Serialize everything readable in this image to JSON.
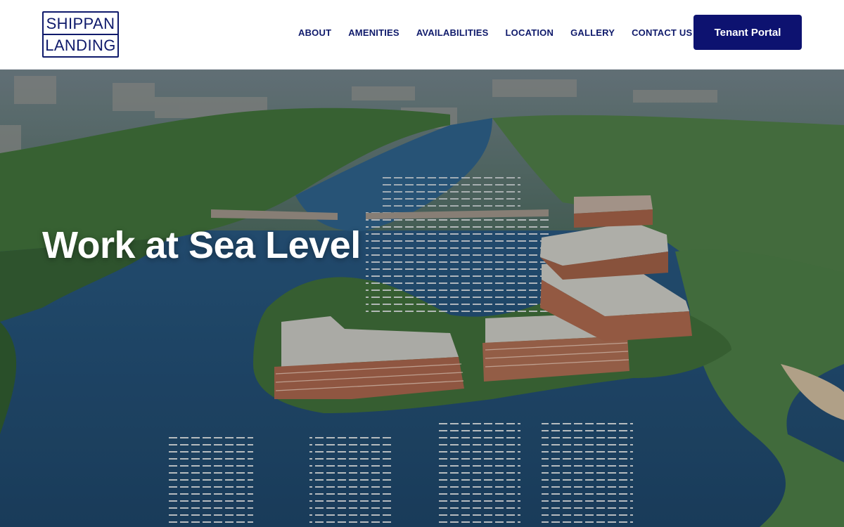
{
  "brand": {
    "logo_line1": "SHIPPAN",
    "logo_line2": "LANDING",
    "color": "#0f1a6b"
  },
  "nav": {
    "items": [
      {
        "label": "ABOUT"
      },
      {
        "label": "AMENITIES"
      },
      {
        "label": "AVAILABILITIES"
      },
      {
        "label": "LOCATION"
      },
      {
        "label": "GALLERY"
      },
      {
        "label": "CONTACT US"
      }
    ]
  },
  "header": {
    "portal_label": "Tenant Portal",
    "portal_color": "#0d1270"
  },
  "hero": {
    "title": "Work at Sea Level",
    "image_icon": "aerial-marina-photo"
  }
}
